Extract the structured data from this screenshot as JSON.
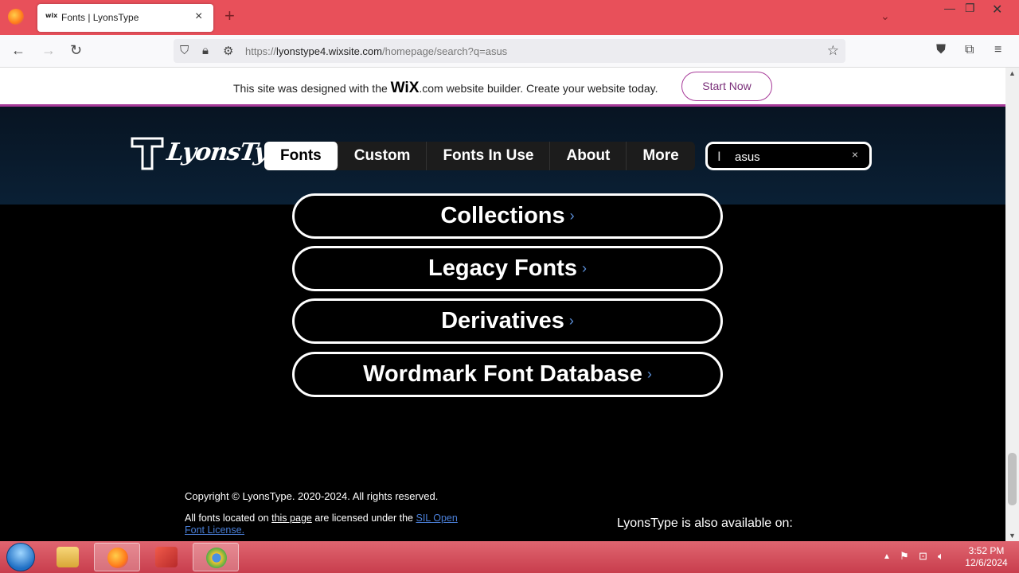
{
  "browser": {
    "tab_favicon": "wix",
    "tab_title": "Fonts | LyonsType",
    "url_prefix": "https://",
    "url_host": "lyonstype4.wixsite.com",
    "url_path": "/homepage/search?q=asus"
  },
  "wix_banner": {
    "text_before": "This site was designed with the ",
    "logo": "WiX",
    "logo_suffix": ".com",
    "text_after": " website builder. Create your website today.",
    "cta": "Start Now"
  },
  "site": {
    "logo_letter": "T",
    "logo_name": "LyonsType",
    "menu": [
      "Fonts",
      "Custom",
      "Fonts In Use",
      "About",
      "More"
    ],
    "search_value": "asus",
    "search_clear": "×"
  },
  "pills": [
    {
      "label": "Collections",
      "arrow": "›"
    },
    {
      "label": "Legacy Fonts",
      "arrow": "›"
    },
    {
      "label": "Derivatives",
      "arrow": "›"
    },
    {
      "label": "Wordmark Font Database",
      "arrow": "›"
    }
  ],
  "footer": {
    "copyright": "Copyright © LyonsType. 2020-2024. All rights reserved.",
    "license_a": "All fonts located on ",
    "license_link1": "this page",
    "license_b": " are licensed under the ",
    "license_link2": "SIL Open Font License.",
    "also_available": "LyonsType is also available on:"
  },
  "taskbar": {
    "time": "3:52 PM",
    "date": "12/6/2024"
  },
  "colors": {
    "tabbar": "#e8505a",
    "wix_accent": "#a73a99",
    "taskbar": "#c83e4d",
    "link": "#4a7fd8"
  }
}
